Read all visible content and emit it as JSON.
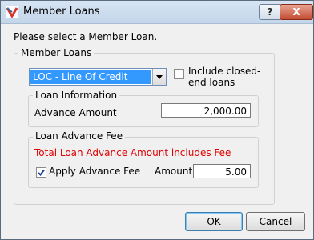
{
  "window": {
    "title": "Member Loans",
    "title_buttons": {
      "help": "?",
      "close": "X"
    }
  },
  "prompt": "Please select a Member Loan.",
  "member_loans_group": {
    "label": "Member Loans",
    "loan_select": {
      "value": "LOC - Line Of Credit"
    },
    "include_closed_end": {
      "label_line1": "Include closed-",
      "label_line2": "end loans",
      "checked": false
    }
  },
  "loan_information": {
    "label": "Loan Information",
    "advance_amount_label": "Advance Amount",
    "advance_amount_value": "2,000.00"
  },
  "loan_advance_fee": {
    "label": "Loan Advance Fee",
    "notice": "Total Loan Advance Amount includes Fee",
    "apply_fee_label": "Apply Advance Fee",
    "apply_fee_checked": true,
    "amount_label": "Amount",
    "amount_value": "5.00"
  },
  "buttons": {
    "ok": "OK",
    "cancel": "Cancel"
  }
}
